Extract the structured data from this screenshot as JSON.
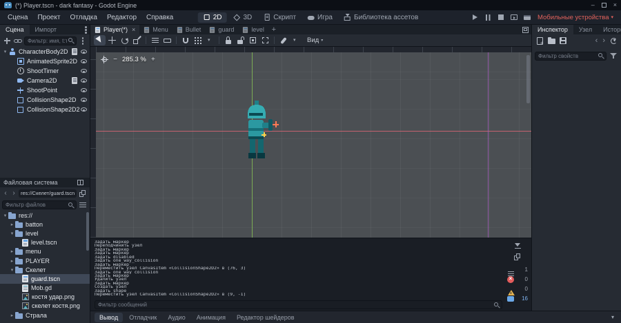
{
  "window": {
    "title": "(*) Player.tscn - dark fantasy - Godot Engine"
  },
  "menubar": {
    "menus": [
      "Сцена",
      "Проект",
      "Отладка",
      "Редактор",
      "Справка"
    ],
    "modes": [
      {
        "label": "2D",
        "active": true
      },
      {
        "label": "3D",
        "active": false
      },
      {
        "label": "Скрипт",
        "active": false
      },
      {
        "label": "Игра",
        "active": false
      },
      {
        "label": "Библиотека ассетов",
        "active": false
      }
    ],
    "run_icons": [
      "play",
      "pause",
      "stop",
      "scene",
      "movie"
    ],
    "remote_label": "Мобильные устройства"
  },
  "scene_dock": {
    "tabs": [
      {
        "label": "Сцена",
        "active": true
      },
      {
        "label": "Импорт",
        "active": false
      }
    ],
    "filter_placeholder": "Фильтр: имя, t:тип,",
    "tree": [
      {
        "name": "CharacterBody2D",
        "icon": "body",
        "depth": 0,
        "arrow": "down",
        "buttons": [
          "script",
          "eye"
        ]
      },
      {
        "name": "AnimatedSprite2D",
        "icon": "sprite",
        "depth": 1,
        "buttons": [
          "eye"
        ]
      },
      {
        "name": "ShootTimer",
        "icon": "timer",
        "depth": 1,
        "buttons": [
          "eye"
        ]
      },
      {
        "name": "Camera2D",
        "icon": "camera",
        "depth": 1,
        "buttons": [
          "script",
          "eye"
        ]
      },
      {
        "name": "ShootPoint",
        "icon": "marker",
        "depth": 1,
        "buttons": [
          "eye"
        ]
      },
      {
        "name": "CollisionShape2D",
        "icon": "shape",
        "depth": 1,
        "buttons": [
          "eye"
        ]
      },
      {
        "name": "CollisionShape2D2",
        "icon": "shape",
        "depth": 1,
        "buttons": [
          "eye"
        ]
      }
    ]
  },
  "filesystem_dock": {
    "title": "Файловая система",
    "path": "res://Скелет/guard.tscn",
    "filter_placeholder": "Фильтр файлов",
    "tree": [
      {
        "name": "res://",
        "icon": "folder",
        "depth": 0,
        "arrow": "down"
      },
      {
        "name": "batton",
        "icon": "folder",
        "depth": 1,
        "arrow": "right"
      },
      {
        "name": "level",
        "icon": "folder",
        "depth": 1,
        "arrow": "down"
      },
      {
        "name": "level.tscn",
        "icon": "scene",
        "depth": 2
      },
      {
        "name": "menu",
        "icon": "folder",
        "depth": 1,
        "arrow": "right"
      },
      {
        "name": "PLAYER",
        "icon": "folder",
        "depth": 1,
        "arrow": "right"
      },
      {
        "name": "Скелет",
        "icon": "folder",
        "depth": 1,
        "arrow": "down"
      },
      {
        "name": "guard.tscn",
        "icon": "scene",
        "depth": 2,
        "selected": true
      },
      {
        "name": "Mob.gd",
        "icon": "script",
        "depth": 2
      },
      {
        "name": "костя удар.png",
        "icon": "image",
        "depth": 2
      },
      {
        "name": "скелет костя.png",
        "icon": "image",
        "depth": 2
      },
      {
        "name": "Страла",
        "icon": "folder",
        "depth": 1,
        "arrow": "right"
      }
    ]
  },
  "viewport": {
    "tabs": [
      {
        "label": "Player(*)",
        "active": true
      },
      {
        "label": "Menu",
        "active": false
      },
      {
        "label": "Bullet",
        "active": false
      },
      {
        "label": "guard",
        "active": false
      },
      {
        "label": "level",
        "active": false
      }
    ],
    "tools": [
      "select",
      "move",
      "rotate",
      "scale",
      "|",
      "list",
      "ruler",
      "|",
      "magnet",
      "grid",
      "caret",
      "|",
      "lock",
      "unlock",
      "group",
      "ungroup",
      "|",
      "bone",
      "caret"
    ],
    "zoom": "285.3 %",
    "view_menu": "Вид"
  },
  "output": {
    "lines": [
      "Задать маркер",
      "Переподчинить узел",
      "Задать маркер",
      "Задать маркер",
      "Задать disabled",
      "Задать one_way_collision",
      "Задать маркер",
      "Переместить узел CanvasItem «CollisionShape2D2» в (76, 3)",
      "Задать one_way_collision",
      "Задать маркер",
      "Удалить узел",
      "Задать маркер",
      "Создать узел",
      "Задать shape",
      "Переместить узел CanvasItem «CollisionShape2D2» в (9, -1)"
    ],
    "filter_placeholder": "Фильтр сообщений",
    "filters": [
      {
        "kind": "list",
        "count": "1"
      },
      {
        "kind": "error",
        "count": "0"
      },
      {
        "kind": "warning",
        "count": "0"
      },
      {
        "kind": "message",
        "count": "16"
      }
    ]
  },
  "bottom_bar": {
    "tabs": [
      {
        "label": "Вывод",
        "active": true
      },
      {
        "label": "Отладчик",
        "active": false
      },
      {
        "label": "Аудио",
        "active": false
      },
      {
        "label": "Анимация",
        "active": false
      },
      {
        "label": "Редактор шейдеров",
        "active": false
      }
    ]
  },
  "inspector": {
    "tabs": [
      {
        "label": "Инспектор",
        "active": true
      },
      {
        "label": "Узел",
        "active": false
      },
      {
        "label": "История",
        "active": false
      }
    ],
    "filter_placeholder": "Фильтр свойств"
  }
}
